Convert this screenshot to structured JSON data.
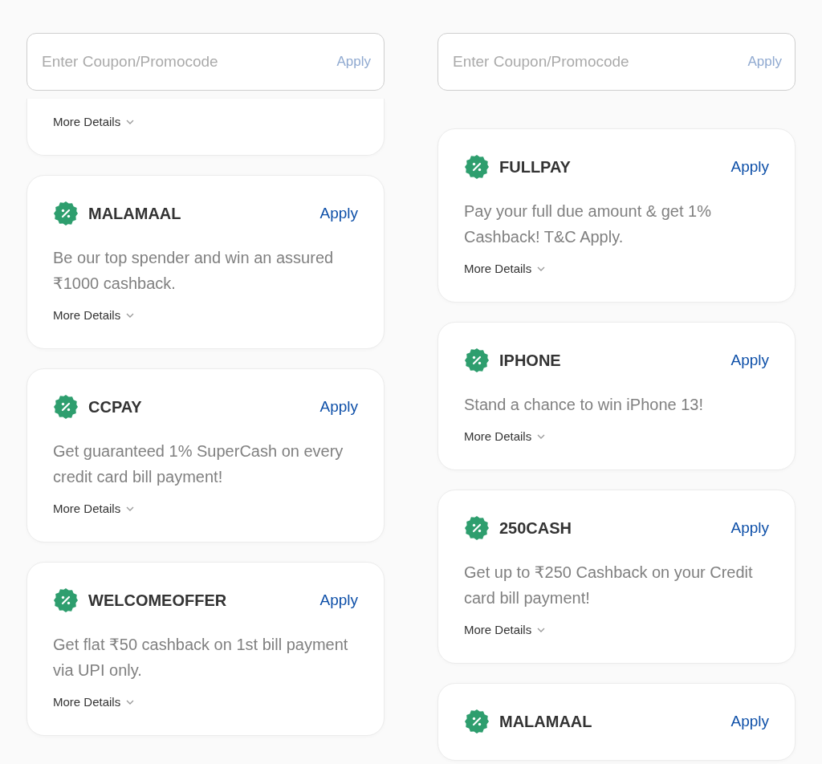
{
  "panels": [
    {
      "coupon_field": {
        "placeholder": "Enter Coupon/Promocode",
        "apply": {
          "label": "Apply",
          "disabled": true
        }
      },
      "offers": [
        {
          "kind": "partial",
          "more_details": "More Details"
        },
        {
          "kind": "full",
          "code": "MALAMAAL",
          "apply": "Apply",
          "description": "Be our top spender and win an assured ₹1000 cashback.",
          "more_details": "More Details"
        },
        {
          "kind": "full",
          "code": "CCPAY",
          "apply": "Apply",
          "description": "Get guaranteed 1% SuperCash on every credit card bill payment!",
          "more_details": "More Details"
        },
        {
          "kind": "full",
          "code": "WELCOMEOFFER",
          "apply": "Apply",
          "description": "Get flat ₹50 cashback on 1st bill payment via UPI only.",
          "more_details": "More Details"
        }
      ]
    },
    {
      "coupon_field": {
        "placeholder": "Enter Coupon/Promocode",
        "apply": {
          "label": "Apply",
          "disabled": true
        }
      },
      "offers": [
        {
          "kind": "full",
          "code": "FULLPAY",
          "apply": "Apply",
          "description": "Pay your full due amount & get 1% Cashback! T&C Apply.",
          "more_details": "More Details"
        },
        {
          "kind": "full",
          "code": "IPHONE",
          "apply": "Apply",
          "description": "Stand a chance to win iPhone 13!",
          "more_details": "More Details"
        },
        {
          "kind": "full",
          "code": "250CASH",
          "apply": "Apply",
          "description": "Get up to ₹250 Cashback on your Credit card bill payment!",
          "more_details": "More Details"
        },
        {
          "kind": "full",
          "code": "MALAMAAL",
          "apply": "Apply"
        }
      ]
    }
  ]
}
